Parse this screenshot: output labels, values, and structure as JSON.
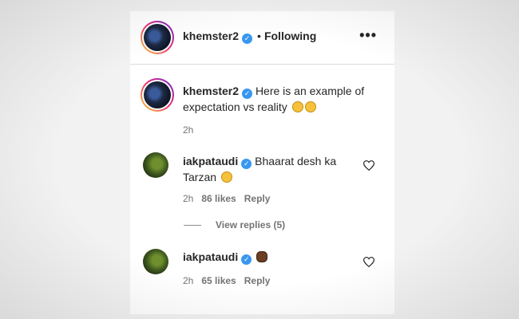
{
  "header": {
    "username": "khemster2",
    "separator": "•",
    "follow_status": "Following",
    "more_label": "•••"
  },
  "post_caption": {
    "username": "khemster2",
    "text": "Here is an example of expectation vs reality",
    "emojis": [
      "face-with-tears-of-joy-emoji",
      "face-with-tears-of-joy-emoji"
    ],
    "time": "2h"
  },
  "comments": [
    {
      "username": "iakpataudi",
      "text_line1": "Bhaarat desh ka",
      "text_line2": "Tarzan",
      "emoji": "rolling-on-floor-laughing-emoji",
      "time": "2h",
      "likes": "86 likes",
      "reply_label": "Reply"
    },
    {
      "username": "iakpataudi",
      "emoji": "monkey-emoji",
      "time": "2h",
      "likes": "65 likes",
      "reply_label": "Reply"
    }
  ],
  "view_replies": "View replies (5)",
  "colors": {
    "verified": "#3897f0",
    "text": "#262626",
    "secondary": "#737373",
    "divider": "#dbdbdb"
  }
}
